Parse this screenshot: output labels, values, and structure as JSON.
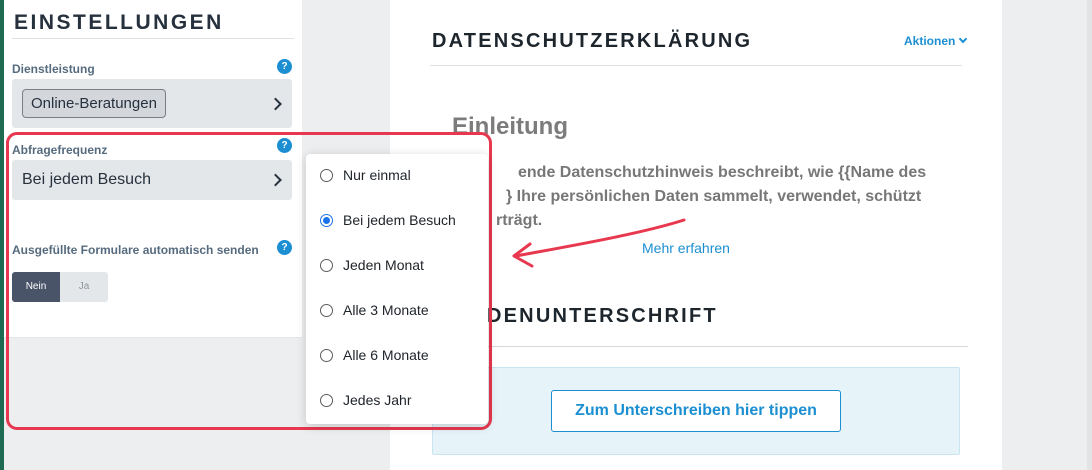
{
  "settings": {
    "title": "EINSTELLUNGEN",
    "service": {
      "label": "Dienstleistung",
      "value": "Online-Beratungen"
    },
    "frequency": {
      "label": "Abfragefrequenz",
      "value": "Bei jedem Besuch"
    },
    "autosubmit": {
      "label": "Ausgefüllte Formulare automatisch senden",
      "no": "Nein",
      "yes": "Ja",
      "selected": "Nein"
    },
    "help_glyph": "?"
  },
  "dropdown": {
    "options": [
      "Nur einmal",
      "Bei jedem Besuch",
      "Jeden Monat",
      "Alle 3 Monate",
      "Alle 6 Monate",
      "Jedes Jahr"
    ],
    "selected_index": 1
  },
  "document": {
    "title": "DATENSCHUTZERKLÄRUNG",
    "actions_label": "Aktionen",
    "intro_heading": "Einleitung",
    "intro_lines": [
      "ende Datenschutzhinweis beschreibt, wie {{Name des",
      "} Ihre persönlichen Daten sammelt, verwendet, schützt",
      "rträgt."
    ],
    "more_link": "Mehr erfahren",
    "signature_heading": "DENUNTERSCHRIFT",
    "signature_button": "Zum Unterschreiben hier tippen"
  },
  "colors": {
    "accent": "#1b8fd2",
    "highlight": "#e8384f",
    "toggle_active": "#4a5468",
    "sidebar_edge": "#1f6b52"
  },
  "icons": [
    "help-icon",
    "chevron-right-icon",
    "chevron-down-icon",
    "annotation-arrow-icon"
  ]
}
